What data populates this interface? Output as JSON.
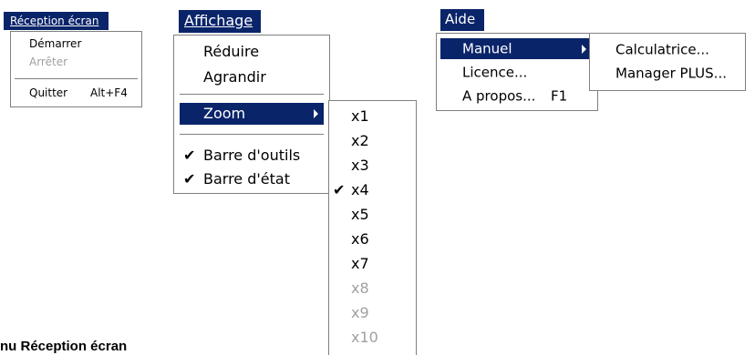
{
  "colors": {
    "highlight": "#0a246a",
    "menu_border": "#808080",
    "disabled_text": "#a0a0a0"
  },
  "menu_reception": {
    "title": "Réception écran",
    "items": [
      {
        "label": "Démarrer"
      },
      {
        "label": "Arrêter",
        "disabled": true
      },
      {
        "label": "Quitter",
        "shortcut": "Alt+F4"
      }
    ]
  },
  "menu_affichage": {
    "title": "Affichage",
    "items": [
      {
        "label": "Réduire"
      },
      {
        "label": "Agrandir"
      },
      {
        "label": "Zoom",
        "submenu": true,
        "selected": true
      },
      {
        "label": "Barre d'outils",
        "checked": true
      },
      {
        "label": "Barre d'état",
        "checked": true
      }
    ]
  },
  "menu_zoom": {
    "items": [
      {
        "label": "x1"
      },
      {
        "label": "x2"
      },
      {
        "label": "x3"
      },
      {
        "label": "x4",
        "checked": true
      },
      {
        "label": "x5"
      },
      {
        "label": "x6"
      },
      {
        "label": "x7"
      },
      {
        "label": "x8",
        "disabled": true
      },
      {
        "label": "x9",
        "disabled": true
      },
      {
        "label": "x10",
        "disabled": true
      }
    ]
  },
  "menu_aide": {
    "title": "Aide",
    "items": [
      {
        "label": "Manuel",
        "submenu": true,
        "selected": true
      },
      {
        "label": "Licence..."
      },
      {
        "label": "A propos...",
        "shortcut": "F1"
      }
    ]
  },
  "menu_manuel": {
    "items": [
      {
        "label": "Calculatrice..."
      },
      {
        "label": "Manager PLUS..."
      }
    ]
  },
  "caption": "nu Réception écran",
  "icons": {
    "check": "check-icon",
    "submenu": "submenu-arrow-icon"
  }
}
